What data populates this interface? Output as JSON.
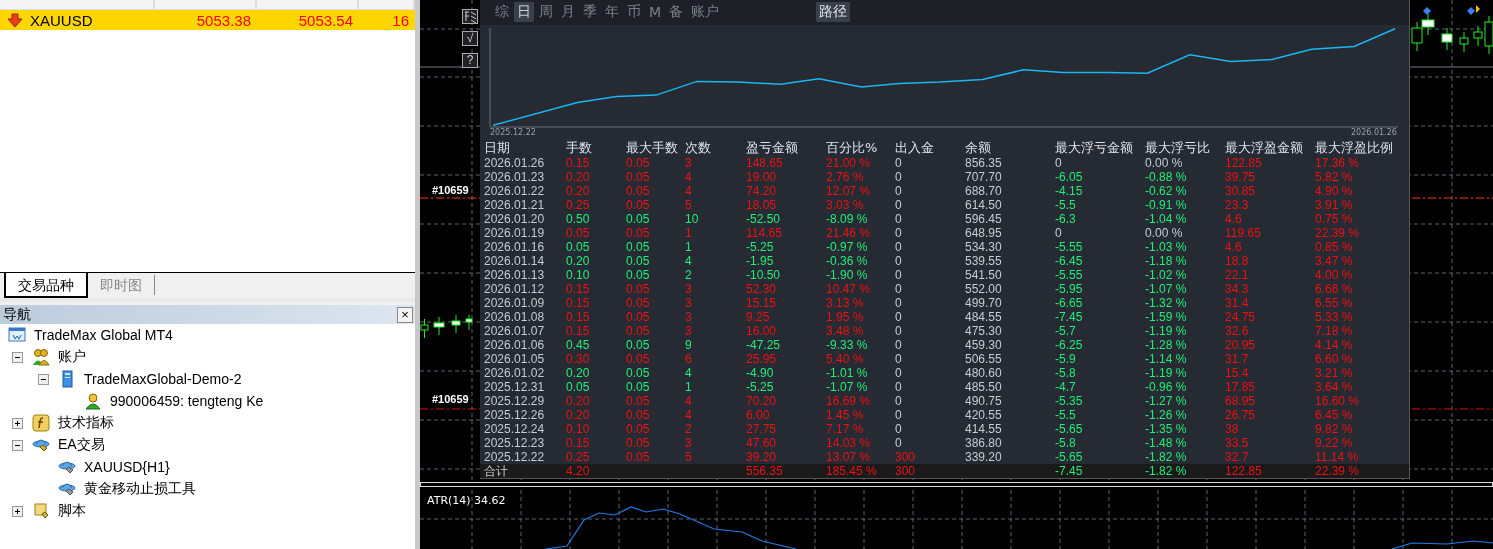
{
  "market_watch": {
    "rows": [
      {
        "symbol": "XAUUSD",
        "bid": "5053.38",
        "ask": "5053.54",
        "spread": "16",
        "selected": true
      }
    ],
    "tabs": [
      {
        "label": "交易品种",
        "selected": true
      },
      {
        "label": "即时图",
        "selected": false
      }
    ]
  },
  "navigator": {
    "title": "导航",
    "close": "×",
    "tree": [
      {
        "kind": "terminal",
        "label": "TradeMax Global MT4",
        "children": [
          {
            "kind": "accounts",
            "label": "账户",
            "expanded": true,
            "children": [
              {
                "kind": "server",
                "label": "TradeMaxGlobal-Demo-2",
                "expanded": true,
                "children": [
                  {
                    "kind": "user",
                    "label": "990006459: tengteng Ke"
                  }
                ]
              }
            ]
          },
          {
            "kind": "indicators",
            "label": "技术指标",
            "expanded": false
          },
          {
            "kind": "experts",
            "label": "EA交易",
            "expanded": true,
            "children": [
              {
                "kind": "expert",
                "label": "XAUUSD{H1}"
              },
              {
                "kind": "expert",
                "label": "黄金移动止损工具"
              }
            ]
          },
          {
            "kind": "scripts",
            "label": "脚本",
            "expanded": false
          }
        ]
      }
    ]
  },
  "chart": {
    "tool_buttons": [
      {
        "kind": "icon"
      },
      {
        "kind": "text",
        "label": "√"
      },
      {
        "kind": "text",
        "label": "?"
      }
    ],
    "order_labels": [
      "#10659",
      "#10659"
    ],
    "indicator": {
      "label": "ATR(14) 34.62"
    }
  },
  "report": {
    "tabs": [
      {
        "label": "综",
        "selected": false
      },
      {
        "label": "日",
        "selected": true
      },
      {
        "label": "周",
        "selected": false
      },
      {
        "label": "月",
        "selected": false
      },
      {
        "label": "季",
        "selected": false
      },
      {
        "label": "年",
        "selected": false
      },
      {
        "label": "币",
        "selected": false
      },
      {
        "label": "M",
        "selected": false
      },
      {
        "label": "备",
        "selected": false
      },
      {
        "label": "账户",
        "selected": false
      }
    ],
    "path_button": "路径",
    "equity": {
      "start_date": "2025.12.22",
      "end_date": "2026.01.26"
    },
    "table": {
      "columns": [
        "日期",
        "手数",
        "最大手数",
        "次数",
        "盈亏金额",
        "百分比%",
        "出入金",
        "余额",
        "最大浮亏金额",
        "最大浮亏比",
        "最大浮盈金额",
        "最大浮盈比例"
      ],
      "rows": [
        {
          "cells": [
            "2026.01.26",
            "0.15",
            "0.05",
            "3",
            "148.65",
            "21.00 %",
            "0",
            "856.35",
            "0",
            "0.00 %",
            "122.85",
            "17.36 %"
          ],
          "loss": false,
          "drawdown": false,
          "deposit": false
        },
        {
          "cells": [
            "2026.01.23",
            "0.20",
            "0.05",
            "4",
            "19.00",
            "2.76 %",
            "0",
            "707.70",
            "-6.05",
            "-0.88 %",
            "39.75",
            "5.82 %"
          ],
          "loss": false,
          "drawdown": true,
          "deposit": false
        },
        {
          "cells": [
            "2026.01.22",
            "0.20",
            "0.05",
            "4",
            "74.20",
            "12.07 %",
            "0",
            "688.70",
            "-4.15",
            "-0.62 %",
            "30.85",
            "4.90 %"
          ],
          "loss": false,
          "drawdown": true,
          "deposit": false
        },
        {
          "cells": [
            "2026.01.21",
            "0.25",
            "0.05",
            "5",
            "18.05",
            "3.03 %",
            "0",
            "614.50",
            "-5.5",
            "-0.91 %",
            "23.3",
            "3.91 %"
          ],
          "loss": false,
          "drawdown": true,
          "deposit": false
        },
        {
          "cells": [
            "2026.01.20",
            "0.50",
            "0.05",
            "10",
            "-52.50",
            "-8.09 %",
            "0",
            "596.45",
            "-6.3",
            "-1.04 %",
            "4.6",
            "0.75 %"
          ],
          "loss": true,
          "drawdown": true,
          "deposit": false
        },
        {
          "cells": [
            "2026.01.19",
            "0.05",
            "0.05",
            "1",
            "114.65",
            "21.46 %",
            "0",
            "648.95",
            "0",
            "0.00 %",
            "119.65",
            "22.39 %"
          ],
          "loss": false,
          "drawdown": false,
          "deposit": false
        },
        {
          "cells": [
            "2026.01.16",
            "0.05",
            "0.05",
            "1",
            "-5.25",
            "-0.97 %",
            "0",
            "534.30",
            "-5.55",
            "-1.03 %",
            "4.6",
            "0.85 %"
          ],
          "loss": true,
          "drawdown": true,
          "deposit": false
        },
        {
          "cells": [
            "2026.01.14",
            "0.20",
            "0.05",
            "4",
            "-1.95",
            "-0.36 %",
            "0",
            "539.55",
            "-6.45",
            "-1.18 %",
            "18.8",
            "3.47 %"
          ],
          "loss": true,
          "drawdown": true,
          "deposit": false
        },
        {
          "cells": [
            "2026.01.13",
            "0.10",
            "0.05",
            "2",
            "-10.50",
            "-1.90 %",
            "0",
            "541.50",
            "-5.55",
            "-1.02 %",
            "22.1",
            "4.00 %"
          ],
          "loss": true,
          "drawdown": true,
          "deposit": false
        },
        {
          "cells": [
            "2026.01.12",
            "0.15",
            "0.05",
            "3",
            "52.30",
            "10.47 %",
            "0",
            "552.00",
            "-5.95",
            "-1.07 %",
            "34.3",
            "6.66 %"
          ],
          "loss": false,
          "drawdown": true,
          "deposit": false
        },
        {
          "cells": [
            "2026.01.09",
            "0.15",
            "0.05",
            "3",
            "15.15",
            "3.13 %",
            "0",
            "499.70",
            "-6.65",
            "-1.32 %",
            "31.4",
            "6.55 %"
          ],
          "loss": false,
          "drawdown": true,
          "deposit": false
        },
        {
          "cells": [
            "2026.01.08",
            "0.15",
            "0.05",
            "3",
            "9.25",
            "1.95 %",
            "0",
            "484.55",
            "-7.45",
            "-1.59 %",
            "24.75",
            "5.33 %"
          ],
          "loss": false,
          "drawdown": true,
          "deposit": false
        },
        {
          "cells": [
            "2026.01.07",
            "0.15",
            "0.05",
            "3",
            "16.00",
            "3.48 %",
            "0",
            "475.30",
            "-5.7",
            "-1.19 %",
            "32.6",
            "7.18 %"
          ],
          "loss": false,
          "drawdown": true,
          "deposit": false
        },
        {
          "cells": [
            "2026.01.06",
            "0.45",
            "0.05",
            "9",
            "-47.25",
            "-9.33 %",
            "0",
            "459.30",
            "-6.25",
            "-1.28 %",
            "20.95",
            "4.14 %"
          ],
          "loss": true,
          "drawdown": true,
          "deposit": false
        },
        {
          "cells": [
            "2026.01.05",
            "0.30",
            "0.05",
            "6",
            "25.95",
            "5.40 %",
            "0",
            "506.55",
            "-5.9",
            "-1.14 %",
            "31.7",
            "6.60 %"
          ],
          "loss": false,
          "drawdown": true,
          "deposit": false
        },
        {
          "cells": [
            "2026.01.02",
            "0.20",
            "0.05",
            "4",
            "-4.90",
            "-1.01 %",
            "0",
            "480.60",
            "-5.8",
            "-1.19 %",
            "15.4",
            "3.21 %"
          ],
          "loss": true,
          "drawdown": true,
          "deposit": false
        },
        {
          "cells": [
            "2025.12.31",
            "0.05",
            "0.05",
            "1",
            "-5.25",
            "-1.07 %",
            "0",
            "485.50",
            "-4.7",
            "-0.96 %",
            "17.85",
            "3.64 %"
          ],
          "loss": true,
          "drawdown": true,
          "deposit": false
        },
        {
          "cells": [
            "2025.12.29",
            "0.20",
            "0.05",
            "4",
            "70.20",
            "16.69 %",
            "0",
            "490.75",
            "-5.35",
            "-1.27 %",
            "68.95",
            "16.60 %"
          ],
          "loss": false,
          "drawdown": true,
          "deposit": false
        },
        {
          "cells": [
            "2025.12.26",
            "0.20",
            "0.05",
            "4",
            "6.00",
            "1.45 %",
            "0",
            "420.55",
            "-5.5",
            "-1.26 %",
            "26.75",
            "6.45 %"
          ],
          "loss": false,
          "drawdown": true,
          "deposit": false
        },
        {
          "cells": [
            "2025.12.24",
            "0.10",
            "0.05",
            "2",
            "27.75",
            "7.17 %",
            "0",
            "414.55",
            "-5.65",
            "-1.35 %",
            "38",
            "9.82 %"
          ],
          "loss": false,
          "drawdown": true,
          "deposit": false
        },
        {
          "cells": [
            "2025.12.23",
            "0.15",
            "0.05",
            "3",
            "47.60",
            "14.03 %",
            "0",
            "386.80",
            "-5.8",
            "-1.48 %",
            "33.5",
            "9.22 %"
          ],
          "loss": false,
          "drawdown": true,
          "deposit": false
        },
        {
          "cells": [
            "2025.12.22",
            "0.25",
            "0.05",
            "5",
            "39.20",
            "13.07 %",
            "300",
            "339.20",
            "-5.65",
            "-1.82 %",
            "32.7",
            "11.14 %"
          ],
          "loss": false,
          "drawdown": true,
          "deposit": true
        }
      ],
      "total": {
        "label": "合计",
        "lots": "4.20",
        "pnl": "556.35",
        "pct": "185.45 %",
        "deposit": "300",
        "max_float_loss": "-7.45",
        "max_float_loss_pct": "-1.82 %",
        "max_float_profit": "122.85",
        "max_float_profit_pct": "22.39 %"
      }
    }
  }
}
